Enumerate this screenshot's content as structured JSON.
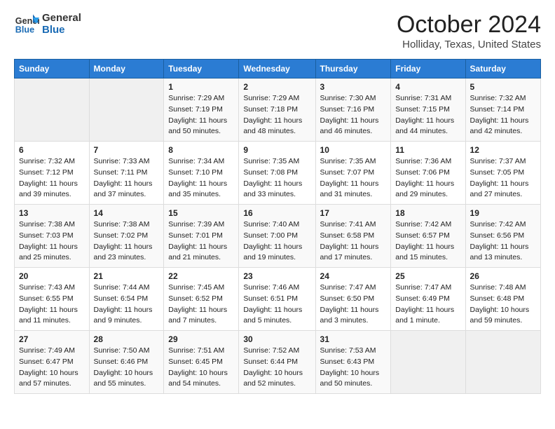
{
  "header": {
    "logo_line1": "General",
    "logo_line2": "Blue",
    "month": "October 2024",
    "location": "Holliday, Texas, United States"
  },
  "weekdays": [
    "Sunday",
    "Monday",
    "Tuesday",
    "Wednesday",
    "Thursday",
    "Friday",
    "Saturday"
  ],
  "weeks": [
    [
      {
        "day": "",
        "sunrise": "",
        "sunset": "",
        "daylight": ""
      },
      {
        "day": "",
        "sunrise": "",
        "sunset": "",
        "daylight": ""
      },
      {
        "day": "1",
        "sunrise": "Sunrise: 7:29 AM",
        "sunset": "Sunset: 7:19 PM",
        "daylight": "Daylight: 11 hours and 50 minutes."
      },
      {
        "day": "2",
        "sunrise": "Sunrise: 7:29 AM",
        "sunset": "Sunset: 7:18 PM",
        "daylight": "Daylight: 11 hours and 48 minutes."
      },
      {
        "day": "3",
        "sunrise": "Sunrise: 7:30 AM",
        "sunset": "Sunset: 7:16 PM",
        "daylight": "Daylight: 11 hours and 46 minutes."
      },
      {
        "day": "4",
        "sunrise": "Sunrise: 7:31 AM",
        "sunset": "Sunset: 7:15 PM",
        "daylight": "Daylight: 11 hours and 44 minutes."
      },
      {
        "day": "5",
        "sunrise": "Sunrise: 7:32 AM",
        "sunset": "Sunset: 7:14 PM",
        "daylight": "Daylight: 11 hours and 42 minutes."
      }
    ],
    [
      {
        "day": "6",
        "sunrise": "Sunrise: 7:32 AM",
        "sunset": "Sunset: 7:12 PM",
        "daylight": "Daylight: 11 hours and 39 minutes."
      },
      {
        "day": "7",
        "sunrise": "Sunrise: 7:33 AM",
        "sunset": "Sunset: 7:11 PM",
        "daylight": "Daylight: 11 hours and 37 minutes."
      },
      {
        "day": "8",
        "sunrise": "Sunrise: 7:34 AM",
        "sunset": "Sunset: 7:10 PM",
        "daylight": "Daylight: 11 hours and 35 minutes."
      },
      {
        "day": "9",
        "sunrise": "Sunrise: 7:35 AM",
        "sunset": "Sunset: 7:08 PM",
        "daylight": "Daylight: 11 hours and 33 minutes."
      },
      {
        "day": "10",
        "sunrise": "Sunrise: 7:35 AM",
        "sunset": "Sunset: 7:07 PM",
        "daylight": "Daylight: 11 hours and 31 minutes."
      },
      {
        "day": "11",
        "sunrise": "Sunrise: 7:36 AM",
        "sunset": "Sunset: 7:06 PM",
        "daylight": "Daylight: 11 hours and 29 minutes."
      },
      {
        "day": "12",
        "sunrise": "Sunrise: 7:37 AM",
        "sunset": "Sunset: 7:05 PM",
        "daylight": "Daylight: 11 hours and 27 minutes."
      }
    ],
    [
      {
        "day": "13",
        "sunrise": "Sunrise: 7:38 AM",
        "sunset": "Sunset: 7:03 PM",
        "daylight": "Daylight: 11 hours and 25 minutes."
      },
      {
        "day": "14",
        "sunrise": "Sunrise: 7:38 AM",
        "sunset": "Sunset: 7:02 PM",
        "daylight": "Daylight: 11 hours and 23 minutes."
      },
      {
        "day": "15",
        "sunrise": "Sunrise: 7:39 AM",
        "sunset": "Sunset: 7:01 PM",
        "daylight": "Daylight: 11 hours and 21 minutes."
      },
      {
        "day": "16",
        "sunrise": "Sunrise: 7:40 AM",
        "sunset": "Sunset: 7:00 PM",
        "daylight": "Daylight: 11 hours and 19 minutes."
      },
      {
        "day": "17",
        "sunrise": "Sunrise: 7:41 AM",
        "sunset": "Sunset: 6:58 PM",
        "daylight": "Daylight: 11 hours and 17 minutes."
      },
      {
        "day": "18",
        "sunrise": "Sunrise: 7:42 AM",
        "sunset": "Sunset: 6:57 PM",
        "daylight": "Daylight: 11 hours and 15 minutes."
      },
      {
        "day": "19",
        "sunrise": "Sunrise: 7:42 AM",
        "sunset": "Sunset: 6:56 PM",
        "daylight": "Daylight: 11 hours and 13 minutes."
      }
    ],
    [
      {
        "day": "20",
        "sunrise": "Sunrise: 7:43 AM",
        "sunset": "Sunset: 6:55 PM",
        "daylight": "Daylight: 11 hours and 11 minutes."
      },
      {
        "day": "21",
        "sunrise": "Sunrise: 7:44 AM",
        "sunset": "Sunset: 6:54 PM",
        "daylight": "Daylight: 11 hours and 9 minutes."
      },
      {
        "day": "22",
        "sunrise": "Sunrise: 7:45 AM",
        "sunset": "Sunset: 6:52 PM",
        "daylight": "Daylight: 11 hours and 7 minutes."
      },
      {
        "day": "23",
        "sunrise": "Sunrise: 7:46 AM",
        "sunset": "Sunset: 6:51 PM",
        "daylight": "Daylight: 11 hours and 5 minutes."
      },
      {
        "day": "24",
        "sunrise": "Sunrise: 7:47 AM",
        "sunset": "Sunset: 6:50 PM",
        "daylight": "Daylight: 11 hours and 3 minutes."
      },
      {
        "day": "25",
        "sunrise": "Sunrise: 7:47 AM",
        "sunset": "Sunset: 6:49 PM",
        "daylight": "Daylight: 11 hours and 1 minute."
      },
      {
        "day": "26",
        "sunrise": "Sunrise: 7:48 AM",
        "sunset": "Sunset: 6:48 PM",
        "daylight": "Daylight: 10 hours and 59 minutes."
      }
    ],
    [
      {
        "day": "27",
        "sunrise": "Sunrise: 7:49 AM",
        "sunset": "Sunset: 6:47 PM",
        "daylight": "Daylight: 10 hours and 57 minutes."
      },
      {
        "day": "28",
        "sunrise": "Sunrise: 7:50 AM",
        "sunset": "Sunset: 6:46 PM",
        "daylight": "Daylight: 10 hours and 55 minutes."
      },
      {
        "day": "29",
        "sunrise": "Sunrise: 7:51 AM",
        "sunset": "Sunset: 6:45 PM",
        "daylight": "Daylight: 10 hours and 54 minutes."
      },
      {
        "day": "30",
        "sunrise": "Sunrise: 7:52 AM",
        "sunset": "Sunset: 6:44 PM",
        "daylight": "Daylight: 10 hours and 52 minutes."
      },
      {
        "day": "31",
        "sunrise": "Sunrise: 7:53 AM",
        "sunset": "Sunset: 6:43 PM",
        "daylight": "Daylight: 10 hours and 50 minutes."
      },
      {
        "day": "",
        "sunrise": "",
        "sunset": "",
        "daylight": ""
      },
      {
        "day": "",
        "sunrise": "",
        "sunset": "",
        "daylight": ""
      }
    ]
  ]
}
